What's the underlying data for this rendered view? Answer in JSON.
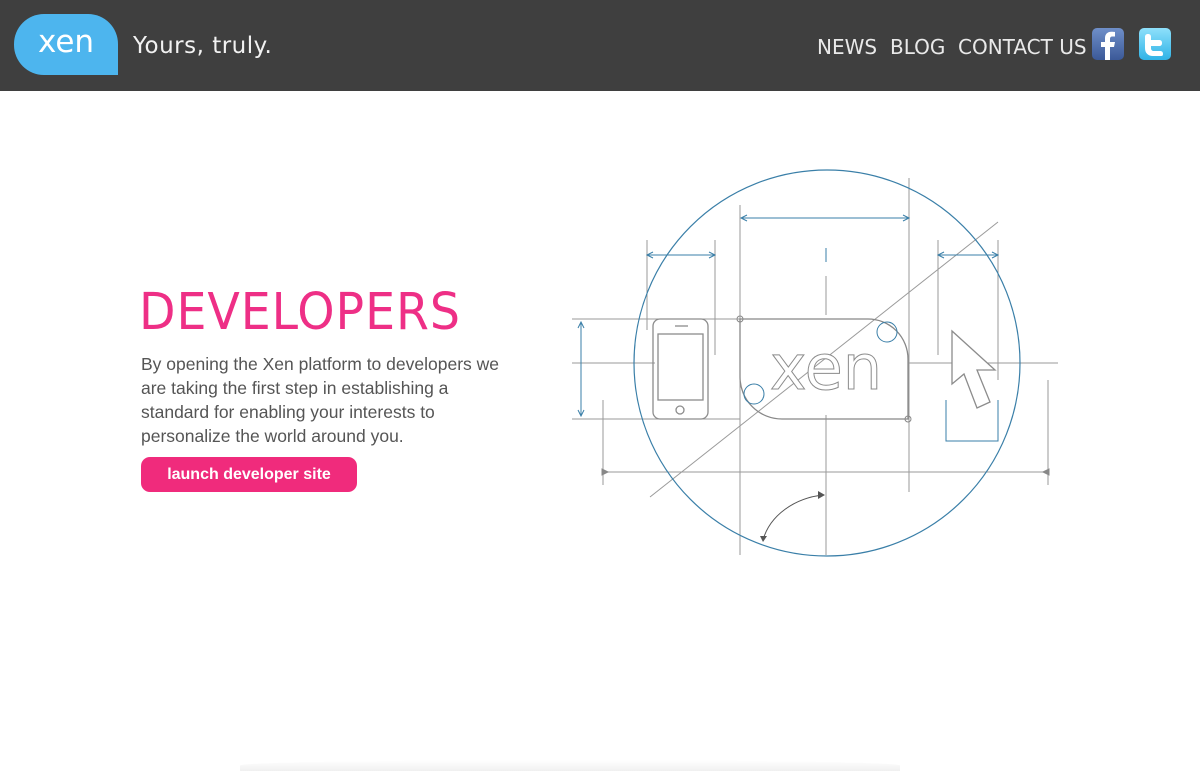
{
  "header": {
    "logo_text": "xen",
    "tagline": "Yours, truly.",
    "nav": [
      "NEWS",
      "BLOG",
      "CONTACT US"
    ],
    "social": [
      "facebook-icon",
      "twitter-icon"
    ]
  },
  "main": {
    "title": "DEVELOPERS",
    "description": "By opening the Xen platform to developers we are taking the first step in establishing a standard for enabling your interests to personalize the world around you.",
    "button_label": "launch developer site"
  },
  "illustration": {
    "logo_text": "xen"
  },
  "colors": {
    "header_bg": "#3f3f3f",
    "brand_blue": "#4db5ee",
    "accent_pink": "#ee2f86",
    "diagram_blue": "#3a7fa8"
  }
}
